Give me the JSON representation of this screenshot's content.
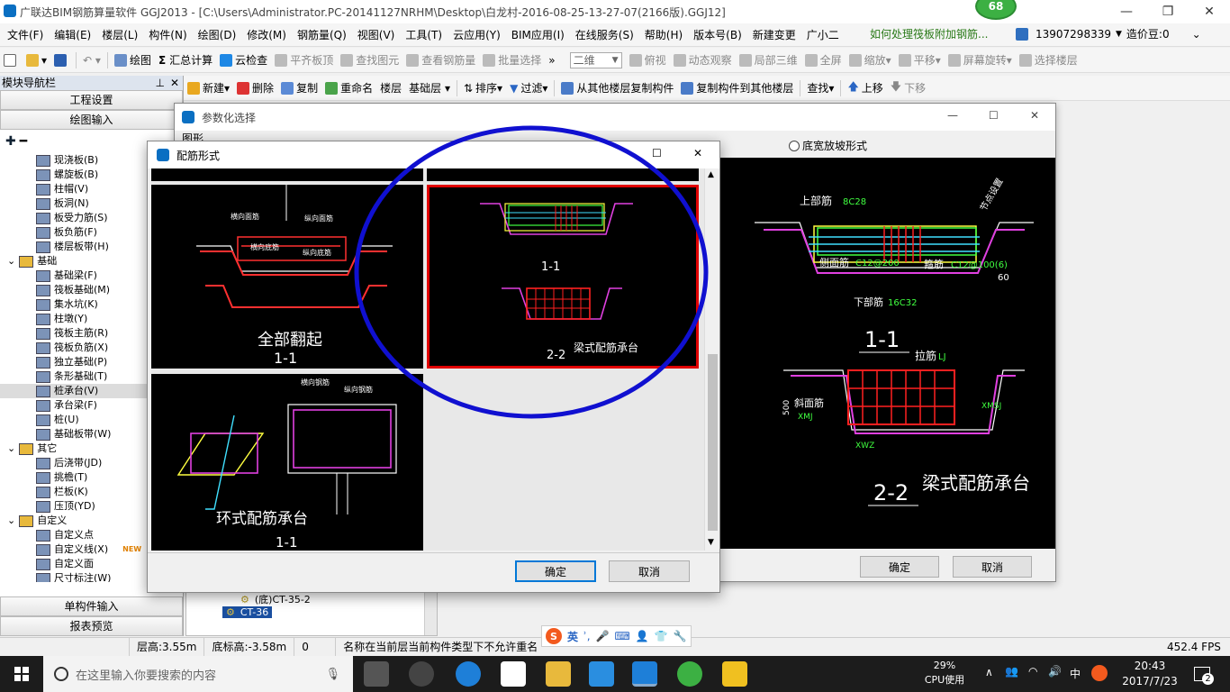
{
  "window": {
    "title": "广联达BIM钢筋算量软件 GGJ2013 - [C:\\Users\\Administrator.PC-20141127NRHM\\Desktop\\白龙村-2016-08-25-13-27-07(2166版).GGJ12]",
    "badge": "68"
  },
  "menu": {
    "items": [
      "文件(F)",
      "编辑(E)",
      "楼层(L)",
      "构件(N)",
      "绘图(D)",
      "修改(M)",
      "钢筋量(Q)",
      "视图(V)",
      "工具(T)",
      "云应用(Y)",
      "BIM应用(I)",
      "在线服务(S)",
      "帮助(H)",
      "版本号(B)",
      "新建变更",
      "广小二"
    ],
    "help_link": "如何处理筏板附加钢筋...",
    "phone": "13907298339",
    "coin": "造价豆:0"
  },
  "toolbar1": {
    "draw": "绘图",
    "sum": "汇总计算",
    "cloud_check": "云检查",
    "align_board": "平齐板顶",
    "find_elem": "查找图元",
    "view_rebar": "查看钢筋量",
    "batch_select": "批量选择",
    "view_mode": "二维",
    "top_view": "俯视",
    "dynamic_view": "动态观察",
    "local_3d": "局部三维",
    "fullscreen": "全屏",
    "zoom": "缩放",
    "pan": "平移",
    "rotate": "屏幕旋转",
    "select_floor": "选择楼层"
  },
  "toolbar2": {
    "new": "新建",
    "delete": "删除",
    "copy": "复制",
    "rename": "重命名",
    "floor_label": "楼层",
    "floor_value": "基础层",
    "sort": "排序",
    "filter": "过滤",
    "copy_from": "从其他楼层复制构件",
    "copy_to": "复制构件到其他楼层",
    "find": "查找",
    "up": "上移",
    "down": "下移"
  },
  "nav": {
    "header": "模块导航栏",
    "project_settings": "工程设置",
    "draw_input": "绘图输入",
    "single_input": "单构件输入",
    "report_preview": "报表预览",
    "tree": [
      {
        "label": "现浇板(B)",
        "indent": 2
      },
      {
        "label": "螺旋板(B)",
        "indent": 2
      },
      {
        "label": "柱帽(V)",
        "indent": 2
      },
      {
        "label": "板洞(N)",
        "indent": 2
      },
      {
        "label": "板受力筋(S)",
        "indent": 2
      },
      {
        "label": "板负筋(F)",
        "indent": 2
      },
      {
        "label": "楼层板带(H)",
        "indent": 2
      },
      {
        "label": "基础",
        "indent": 1
      },
      {
        "label": "基础梁(F)",
        "indent": 2
      },
      {
        "label": "筏板基础(M)",
        "indent": 2
      },
      {
        "label": "集水坑(K)",
        "indent": 2
      },
      {
        "label": "柱墩(Y)",
        "indent": 2
      },
      {
        "label": "筏板主筋(R)",
        "indent": 2
      },
      {
        "label": "筏板负筋(X)",
        "indent": 2
      },
      {
        "label": "独立基础(P)",
        "indent": 2
      },
      {
        "label": "条形基础(T)",
        "indent": 2
      },
      {
        "label": "桩承台(V)",
        "indent": 2
      },
      {
        "label": "承台梁(F)",
        "indent": 2
      },
      {
        "label": "桩(U)",
        "indent": 2
      },
      {
        "label": "基础板带(W)",
        "indent": 2
      },
      {
        "label": "其它",
        "indent": 1
      },
      {
        "label": "后浇带(JD)",
        "indent": 2
      },
      {
        "label": "挑檐(T)",
        "indent": 2
      },
      {
        "label": "栏板(K)",
        "indent": 2
      },
      {
        "label": "压顶(YD)",
        "indent": 2
      },
      {
        "label": "自定义",
        "indent": 1
      },
      {
        "label": "自定义点",
        "indent": 2
      },
      {
        "label": "自定义线(X)",
        "indent": 2
      },
      {
        "label": "自定义面",
        "indent": 2
      },
      {
        "label": "尺寸标注(W)",
        "indent": 2
      }
    ],
    "new_badge": "NEW"
  },
  "list": {
    "item1": "(底)CT-35-2",
    "item2": "CT-36"
  },
  "param_dialog": {
    "title": "参数化选择",
    "group_label": "图形",
    "radio_label": "底宽放坡形式",
    "ok": "确定",
    "cancel": "取消",
    "preview": {
      "top_rebar": "上部筋",
      "top_rebar_val": "8C28",
      "side_rebar": "侧面筋",
      "side_rebar_val": "C12@200",
      "stirrup": "箍筋",
      "stirrup_val": "C12@100(6)",
      "bottom_rebar": "下部筋",
      "bottom_rebar_val": "16C32",
      "section1": "1-1",
      "tie": "拉筋",
      "tie_val": "LJ",
      "slope_rebar": "斜面筋",
      "slope_val": "XMJ",
      "xmsj": "XMSJ",
      "xwz": "XWZ",
      "section2": "2-2",
      "caption": "梁式配筋承台",
      "dim60": "60",
      "dim500": "500",
      "node": "节点设置"
    }
  },
  "peijin_dialog": {
    "title": "配筋形式",
    "ok": "确定",
    "cancel": "取消",
    "cards": [
      {
        "caption": "全部翻起",
        "section": "1-1",
        "l1": "横向面筋",
        "l2": "纵向面筋",
        "l3": "横向底筋",
        "l4": "纵向底筋"
      },
      {
        "caption": "梁式配筋承台",
        "section_a": "1-1",
        "section_b": "2-2"
      },
      {
        "caption": "环式配筋承台",
        "section": "1-1",
        "l1": "横向钢筋",
        "l2": "纵向钢筋"
      }
    ]
  },
  "status": {
    "floor_height": "层高:3.55m",
    "bottom_height": "底标高:-3.58m",
    "zero": "0",
    "message": "名称在当前层当前构件类型下不允许重名",
    "fps": "452.4 FPS"
  },
  "ime": {
    "label": "英"
  },
  "taskbar": {
    "search_placeholder": "在这里输入你要搜索的内容",
    "cpu_pct": "29%",
    "cpu_label": "CPU使用",
    "lang": "中",
    "time": "20:43",
    "date": "2017/7/23",
    "notif": "2"
  },
  "colors": {
    "highlight_circle": "#1010d0",
    "selected_card_border": "#e00000",
    "cad_bg": "#000000"
  }
}
